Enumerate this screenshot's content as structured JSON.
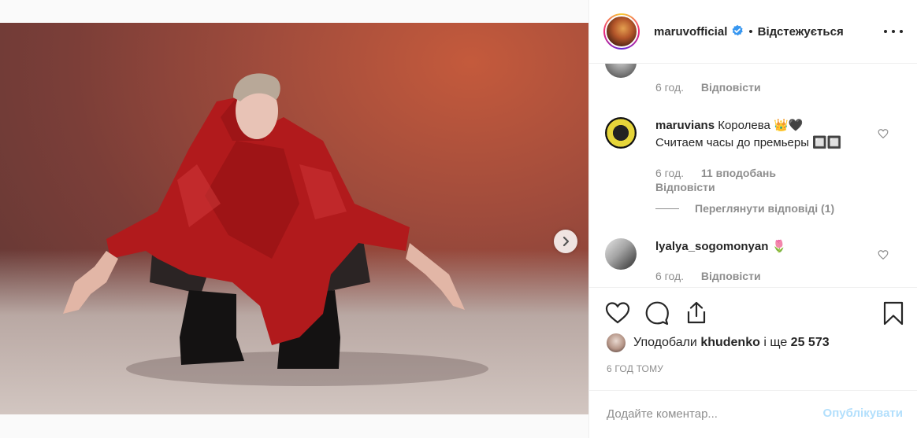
{
  "media": {
    "next_label": "next",
    "slides": 3,
    "active_slide": 1
  },
  "header": {
    "username": "maruvofficial",
    "separator": "•",
    "follow_status": "Відстежується",
    "verified_icon": "verified-badge-icon",
    "more_icon": "more-options-icon"
  },
  "comments": [
    {
      "username": "",
      "text": "",
      "time": "6 год.",
      "likes": "",
      "reply_label": "Відповісти"
    },
    {
      "username": "maruvians",
      "text_line1": "Королева 👑🖤",
      "text_line2": "Считаем часы до премьеры 🔲🔲",
      "time": "6 год.",
      "likes": "11 вподобань",
      "reply_label": "Відповісти",
      "view_replies": "Переглянути відповіді (1)"
    },
    {
      "username": "lyalya_sogomonyan",
      "text": "🌷",
      "time": "6 год.",
      "reply_label": "Відповісти"
    }
  ],
  "actions": {
    "like_icon": "heart-icon",
    "comment_icon": "comment-icon",
    "share_icon": "share-icon",
    "save_icon": "bookmark-icon"
  },
  "likes": {
    "prefix": "Уподобали",
    "user": "khudenko",
    "middle": "і ще",
    "count": "25 573"
  },
  "timestamp": "6 ГОД ТОМУ",
  "add_comment": {
    "placeholder": "Додайте коментар...",
    "publish_label": "Опублікувати"
  },
  "colors": {
    "link_disabled": "#b2dffc",
    "muted": "#8e8e8e",
    "text": "#262626"
  }
}
